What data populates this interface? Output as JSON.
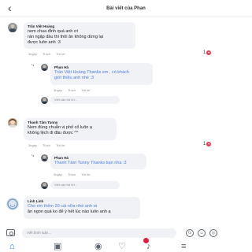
{
  "header": {
    "back_icon": "chevron-left-icon",
    "title": "Bài viết của Phan"
  },
  "comments": [
    {
      "name": "Trần Việt Hoàng",
      "lines": [
        "nem chua đỉnh quá anh ơi",
        "rán ngập dầu thì thôi ăn không dừng lại",
        "được luôn anh :3"
      ],
      "meta": [
        "3ngày",
        "Thích",
        "Trả lời"
      ],
      "count": "1"
    },
    {
      "name": "Phan Hà",
      "lines": [
        "Trần Việt Hoàng Thanks em , có khách",
        "giới thiệu anh nhé :3"
      ],
      "meta": [
        "3ngày",
        "Thích",
        "Trả lời"
      ]
    },
    {
      "placeholder": "Viết câu trả lời..."
    },
    {
      "name": "Thanh Tâm Tunny",
      "lines": [
        "Nem đúng chuẩn vị phố cổ luôn ạ",
        "không lệch đi đâu được ^^"
      ],
      "meta": [
        "3ngày",
        "Thích",
        "Trả lời"
      ],
      "count": "1"
    },
    {
      "name": "Phan Hà",
      "lines": [
        "Thanh Tâm Tunny Thanks bạn nha :3"
      ],
      "meta": [
        "3ngày",
        "Thích",
        "Trả lời"
      ]
    },
    {
      "placeholder": "Viết câu trả lời..."
    },
    {
      "name": "Linh Linh",
      "lines": [
        "Cho em thêm 20 cái nữa nhé anh ơi",
        "ăn ngon quá ko để ý hết lúc nào luôn anh ạ"
      ]
    }
  ],
  "composer": {
    "placeholder": "Viết bình luận..."
  },
  "nav": [
    "home-icon",
    "video-icon",
    "messenger-icon",
    "marketplace-icon",
    "notifications-icon",
    "menu-icon"
  ],
  "colors": {
    "accent": "#1877f2",
    "like": "#e8344e"
  }
}
